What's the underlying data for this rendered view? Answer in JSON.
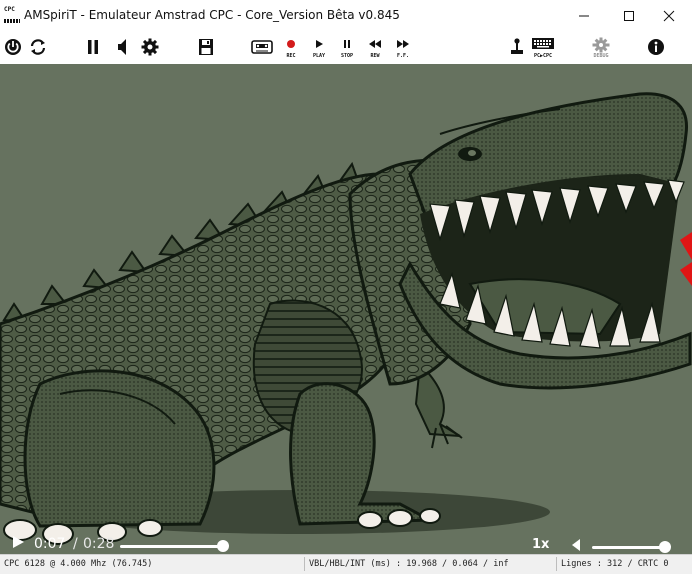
{
  "window": {
    "title": "AMSpiriT - Emulateur Amstrad CPC - Core_Version Bêta v0.845",
    "app_icon_text": "CPC"
  },
  "toolbar": {
    "rec_label": "REC",
    "play_label": "PLAY",
    "stop_label": "STOP",
    "rew_label": "REW",
    "ff_label": "F.F.",
    "pc_cpc_label": "PC▶CPC",
    "debug_label": "DEBUG"
  },
  "player": {
    "current_time": "0:07",
    "separator": "/",
    "duration": "0:28",
    "speed": "1x",
    "progress": 0.25,
    "volume": 0.9
  },
  "status": {
    "cpc": "CPC 6128 @ 4.000 Mhz (76.745)",
    "timing": "VBL/HBL/INT (ms) : 19.968 / 0.064 / inf",
    "lines": "Lignes : 312 / CRTC 0"
  },
  "colors": {
    "screen_bg": "#66725f",
    "dino_dark": "#3b4533",
    "dino_mid": "#4b5943",
    "outline": "#111a10",
    "mouth": "#1c2418",
    "teeth": "#f3efe9",
    "accent_red": "#e01515"
  }
}
